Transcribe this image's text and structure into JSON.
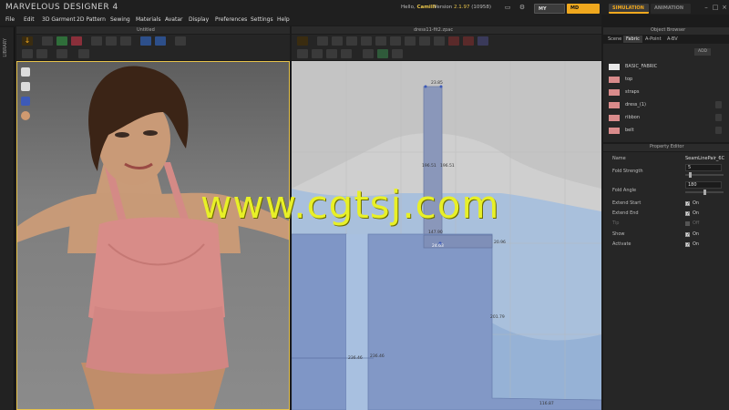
{
  "app": {
    "title": "MARVELOUS DESIGNER 4",
    "hello_prefix": "Hello,",
    "user": "Camilli",
    "version_label": "Version",
    "version": "2.1.97",
    "build": "(10958)"
  },
  "top_buttons": {
    "my_page": "MY PAGE",
    "md_store": "MD STORE",
    "simulation": "SIMULATION",
    "animation": "ANIMATION"
  },
  "menu": [
    "File",
    "Edit",
    "3D Garment",
    "2D Pattern",
    "Sewing",
    "Materials",
    "Avatar",
    "Display",
    "Preferences",
    "Settings",
    "Help"
  ],
  "library_label": "LIBRARY",
  "panel3d": {
    "title": "Untitled"
  },
  "panel2d": {
    "title": "dress11-fit2.zpac"
  },
  "object_browser": {
    "title": "Object Browser",
    "tabs": [
      "Scene",
      "Fabric",
      "A-Point",
      "A-BV"
    ],
    "add_label": "ADD",
    "fabrics": [
      {
        "name": "BASIC_FABRIC",
        "color": "#e8e8e8",
        "lock": false
      },
      {
        "name": "top",
        "color": "#d98b8b",
        "lock": false
      },
      {
        "name": "straps",
        "color": "#d98b8b",
        "lock": false
      },
      {
        "name": "dress_(1)",
        "color": "#d98b8b",
        "lock": true
      },
      {
        "name": "ribbon",
        "color": "#d98b8b",
        "lock": true
      },
      {
        "name": "belt",
        "color": "#d98b8b",
        "lock": true
      }
    ]
  },
  "property_editor": {
    "title": "Property Editor",
    "name_label": "Name",
    "name_value": "SeamLinePair_6C",
    "fold_strength_label": "Fold Strength",
    "fold_strength_value": "5",
    "fold_angle_label": "Fold Angle",
    "fold_angle_value": "180",
    "extend_start_label": "Extend Start",
    "extend_start_value": "On",
    "extend_end_label": "Extend End",
    "extend_end_value": "On",
    "tip_label": "Tip",
    "tip_value": "Off",
    "show_label": "Show",
    "show_value": "On",
    "activate_label": "Activate",
    "activate_value": "On"
  },
  "measurements": {
    "top_width": "23.85",
    "strap_left": "196.51",
    "strap_right": "196.51",
    "strap_bottom": "147.90",
    "strap_bottom2": "24.63",
    "side": "20.96",
    "right_height": "201.79",
    "left_height_a": "236.46",
    "left_height_b": "236.46",
    "bottom": "116.87"
  },
  "watermark": "www.cgtsj.com",
  "colors": {
    "accent": "#f0a81e",
    "viewport_border": "#e6c24a",
    "pattern_blue": "#8fa6cc",
    "watermark": "#e8f028"
  }
}
